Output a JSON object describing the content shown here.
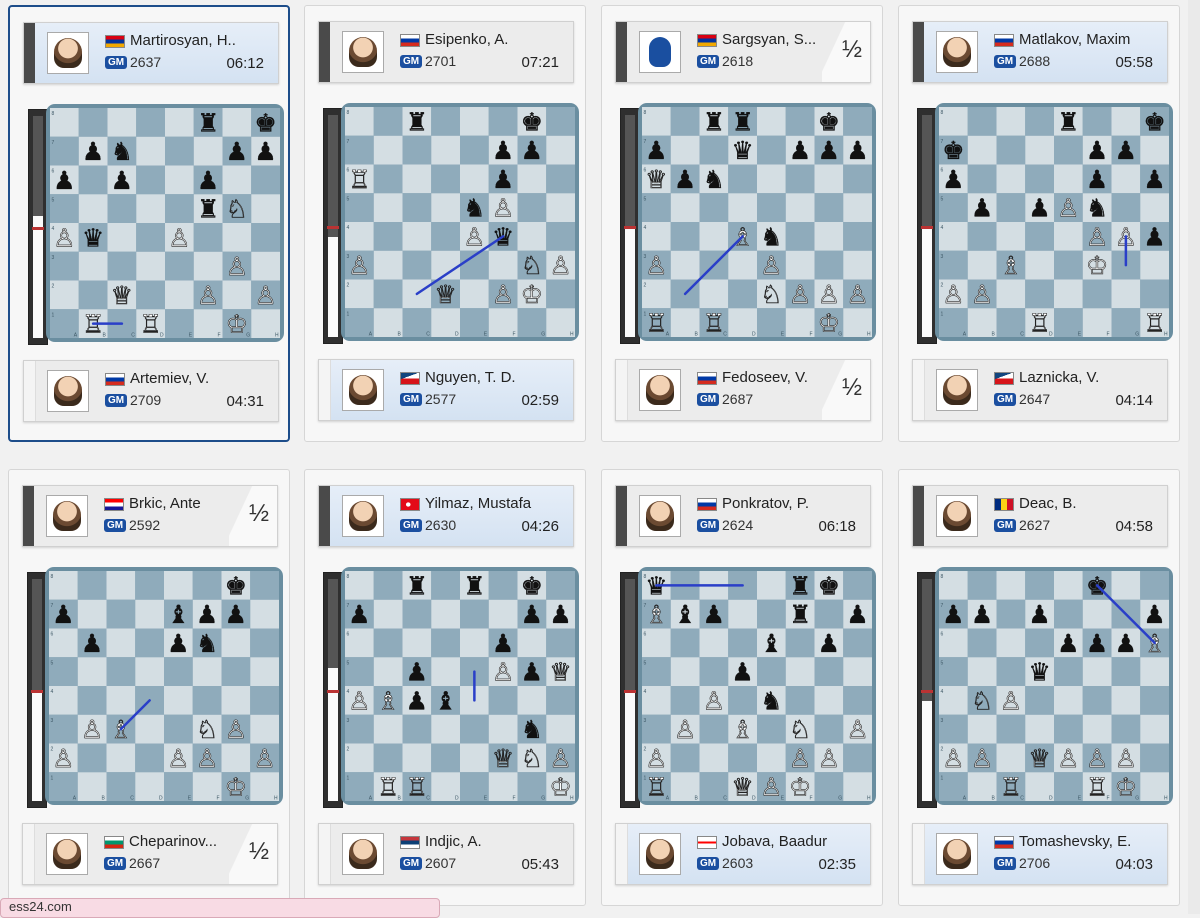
{
  "colors": {
    "light_square": "#d4dee3",
    "dark_square": "#8fabbb",
    "arrow": "#2a3fc8",
    "gm_badge": "#1b4fa0"
  },
  "footer": {
    "site_text": "ess24.com"
  },
  "games": [
    {
      "selected": true,
      "top": {
        "name": "Martirosyan, H..",
        "title": "GM",
        "rating": "2637",
        "clock": "06:12",
        "flag": "armenia",
        "photo": "player-photo",
        "moving": true,
        "result": ""
      },
      "bottom": {
        "name": "Artemiev, V.",
        "title": "GM",
        "rating": "2709",
        "clock": "04:31",
        "flag": "russia",
        "photo": "player-photo",
        "moving": false,
        "result": ""
      },
      "eval_white_fraction": 0.55,
      "pieces": [
        "f8:bR",
        "h8:bK",
        "b7:bP",
        "c7:bN",
        "g7:bP",
        "h7:bP",
        "a6:bP",
        "c6:bP",
        "f6:bP",
        "f5:bR",
        "g5:wN",
        "a4:wP",
        "b4:bQ",
        "e4:wP",
        "g3:wP",
        "c2:wQ",
        "f2:wP",
        "h2:wP",
        "b1:wR",
        "d1:wR",
        "g1:wK"
      ],
      "arrows": [
        [
          "c1",
          "b1"
        ]
      ]
    },
    {
      "selected": false,
      "top": {
        "name": "Esipenko, A.",
        "title": "GM",
        "rating": "2701",
        "clock": "07:21",
        "flag": "russia",
        "photo": "player-photo",
        "moving": false,
        "result": ""
      },
      "bottom": {
        "name": "Nguyen, T. D.",
        "title": "GM",
        "rating": "2577",
        "clock": "02:59",
        "flag": "czech",
        "photo": "player-photo",
        "moving": true,
        "result": ""
      },
      "eval_white_fraction": 0.45,
      "pieces": [
        "c8:bR",
        "g8:bK",
        "f7:bP",
        "g7:bP",
        "a6:wR",
        "f6:bP",
        "e5:bN",
        "f5:wP",
        "e4:wP",
        "f4:bQ",
        "g3:wN",
        "h3:wP",
        "a3:wP",
        "d2:wQ",
        "f2:wP",
        "g2:wK"
      ],
      "arrows": [
        [
          "c2",
          "f4"
        ]
      ]
    },
    {
      "selected": false,
      "top": {
        "name": "Sargsyan, S...",
        "title": "GM",
        "rating": "2618",
        "clock": "",
        "flag": "armenia",
        "photo": "silhouette",
        "moving": false,
        "result": "½"
      },
      "bottom": {
        "name": "Fedoseev, V.",
        "title": "GM",
        "rating": "2687",
        "clock": "",
        "flag": "russia",
        "photo": "player-photo",
        "moving": false,
        "result": "½"
      },
      "eval_white_fraction": 0.5,
      "pieces": [
        "c8:bR",
        "d8:bR",
        "g8:bK",
        "a7:bP",
        "d7:bQ",
        "f7:bP",
        "g7:bP",
        "h7:bP",
        "a6:wQ",
        "b6:bP",
        "c6:bN",
        "d4:wB",
        "e4:bN",
        "a3:wP",
        "e3:wP",
        "f2:wP",
        "g2:wP",
        "h2:wP",
        "e2:wN",
        "a1:wR",
        "c1:wR",
        "g1:wK"
      ],
      "arrows": [
        [
          "b2",
          "d4"
        ]
      ]
    },
    {
      "selected": false,
      "top": {
        "name": "Matlakov, Maxim",
        "title": "GM",
        "rating": "2688",
        "clock": "05:58",
        "flag": "russia",
        "photo": "player-photo",
        "moving": true,
        "result": ""
      },
      "bottom": {
        "name": "Laznicka, V.",
        "title": "GM",
        "rating": "2647",
        "clock": "04:14",
        "flag": "czech",
        "photo": "player-photo",
        "moving": false,
        "result": ""
      },
      "eval_white_fraction": 0.5,
      "pieces": [
        "e8:bR",
        "h8:bK",
        "a7:bK2",
        "f7:bP",
        "g7:bP",
        "a6:bP",
        "f6:bP",
        "h6:bP",
        "b5:bP",
        "d5:bP",
        "e5:wP",
        "f5:bN",
        "f4:wP",
        "g4:wP",
        "h4:bP",
        "c3:wB",
        "f3:wK",
        "a2:wP",
        "b2:wP",
        "d1:wR",
        "h1:wR"
      ],
      "arrows": [
        [
          "g4",
          "g3"
        ]
      ]
    },
    {
      "selected": false,
      "top": {
        "name": "Brkic, Ante",
        "title": "GM",
        "rating": "2592",
        "clock": "",
        "flag": "croatia",
        "photo": "player-photo",
        "moving": false,
        "result": "½"
      },
      "bottom": {
        "name": "Cheparinov...",
        "title": "GM",
        "rating": "2667",
        "clock": "",
        "flag": "bulgaria",
        "photo": "player-photo",
        "moving": false,
        "result": "½"
      },
      "eval_white_fraction": 0.5,
      "pieces": [
        "g8:bK",
        "a7:bP",
        "e7:bB",
        "f7:bP",
        "g7:bP",
        "b6:bP",
        "e6:bP",
        "f6:bN",
        "b3:wP",
        "c3:wB",
        "f3:wN",
        "g3:wP",
        "a2:wP",
        "e2:wP",
        "f2:wP",
        "h2:wP",
        "g1:wK"
      ],
      "arrows": [
        [
          "d4",
          "c3"
        ]
      ]
    },
    {
      "selected": false,
      "top": {
        "name": "Yilmaz, Mustafa",
        "title": "GM",
        "rating": "2630",
        "clock": "04:26",
        "flag": "turkey",
        "photo": "player-photo",
        "moving": true,
        "result": ""
      },
      "bottom": {
        "name": "Indjic, A.",
        "title": "GM",
        "rating": "2607",
        "clock": "05:43",
        "flag": "serbia",
        "photo": "player-photo",
        "moving": false,
        "result": ""
      },
      "eval_white_fraction": 0.6,
      "pieces": [
        "c8:bR",
        "e8:bR",
        "g8:bK",
        "a7:bP",
        "g7:bP",
        "h7:bP",
        "f6:bP",
        "c5:bP",
        "f5:wP",
        "g5:bP",
        "h5:wQ",
        "a4:wP",
        "b4:wB",
        "c4:bP",
        "d4:bB",
        "g3:bN",
        "f2:wQ",
        "g2:wN",
        "h2:wP",
        "b1:wR",
        "c1:wR",
        "h1:wK"
      ],
      "arrows": [
        [
          "e4",
          "e5"
        ]
      ]
    },
    {
      "selected": false,
      "top": {
        "name": "Ponkratov, P.",
        "title": "GM",
        "rating": "2624",
        "clock": "06:18",
        "flag": "russia",
        "photo": "player-photo",
        "moving": false,
        "result": ""
      },
      "bottom": {
        "name": "Jobava, Baadur",
        "title": "GM",
        "rating": "2603",
        "clock": "02:35",
        "flag": "georgia",
        "photo": "player-photo",
        "moving": true,
        "result": ""
      },
      "eval_white_fraction": 0.5,
      "pieces": [
        "a8:bQ",
        "f8:bR",
        "g8:bK",
        "a7:wB",
        "b7:bB",
        "c7:bP",
        "f7:bR",
        "h7:bP",
        "e6:bB",
        "g6:bP",
        "d5:bP",
        "c4:wP",
        "e4:bN",
        "b3:wP",
        "d3:wB",
        "f3:wN",
        "h3:wP",
        "a2:wP",
        "f2:wP",
        "g2:wP",
        "a1:wR",
        "d1:wQ",
        "e1:wP",
        "f1:wK"
      ],
      "arrows": [
        [
          "d8",
          "a8"
        ]
      ]
    },
    {
      "selected": false,
      "top": {
        "name": "Deac, B.",
        "title": "GM",
        "rating": "2627",
        "clock": "04:58",
        "flag": "romania",
        "photo": "player-photo",
        "moving": false,
        "result": ""
      },
      "bottom": {
        "name": "Tomashevsky, E.",
        "title": "GM",
        "rating": "2706",
        "clock": "04:03",
        "flag": "russia",
        "photo": "player-photo",
        "moving": true,
        "result": ""
      },
      "eval_white_fraction": 0.45,
      "pieces": [
        "f8:bK",
        "a7:bP",
        "b7:bP",
        "d7:bP",
        "h7:bP",
        "e6:bP",
        "f6:bP",
        "g6:bP",
        "h6:wB",
        "d5:bQ",
        "b4:wN",
        "c4:wP",
        "a2:wP",
        "b2:wP",
        "d2:wQ",
        "e2:wP",
        "f2:wP",
        "g2:wP",
        "c1:wR",
        "f1:wR",
        "g1:wK"
      ],
      "arrows": [
        [
          "f8",
          "h6"
        ]
      ]
    }
  ]
}
